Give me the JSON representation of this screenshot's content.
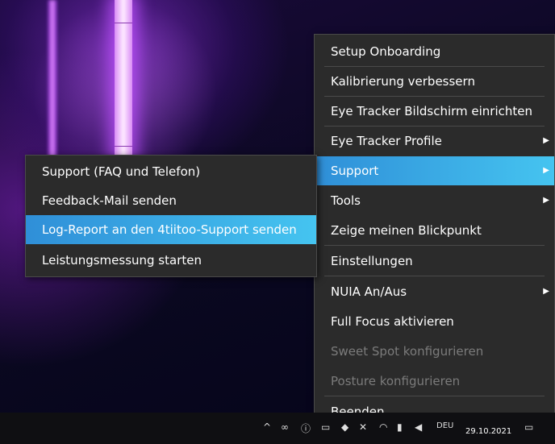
{
  "main_menu": {
    "items": [
      {
        "label": "Setup Onboarding"
      },
      {
        "label": "Kalibrierung verbessern"
      },
      {
        "label": "Eye Tracker Bildschirm einrichten"
      },
      {
        "label": "Eye Tracker Profile"
      },
      {
        "label": "Support"
      },
      {
        "label": "Tools"
      },
      {
        "label": "Zeige meinen Blickpunkt"
      },
      {
        "label": "Einstellungen"
      },
      {
        "label": "NUIA An/Aus"
      },
      {
        "label": "Full Focus aktivieren"
      },
      {
        "label": "Sweet Spot konfigurieren"
      },
      {
        "label": "Posture konfigurieren"
      },
      {
        "label": "Beenden"
      }
    ]
  },
  "submenu": {
    "items": [
      {
        "label": "Support (FAQ und Telefon)"
      },
      {
        "label": "Feedback-Mail senden"
      },
      {
        "label": "Log-Report an den 4tiitoo-Support senden"
      },
      {
        "label": "Leistungsmessung starten"
      }
    ]
  },
  "taskbar": {
    "date": "29.10.2021",
    "language": "DEU",
    "icons": [
      "chevron-up-icon",
      "link-icon",
      "info-icon",
      "network-icon",
      "shield-icon",
      "tool-icon",
      "wifi-icon",
      "battery-icon",
      "tablet-icon",
      "volume-icon",
      "notification-icon"
    ]
  },
  "colors": {
    "menu_bg": "#2b2b2b",
    "highlight_start": "#2f8fd8",
    "highlight_end": "#45c4f0",
    "disabled_text": "#7b7b7b",
    "neon": "#c050ff"
  }
}
